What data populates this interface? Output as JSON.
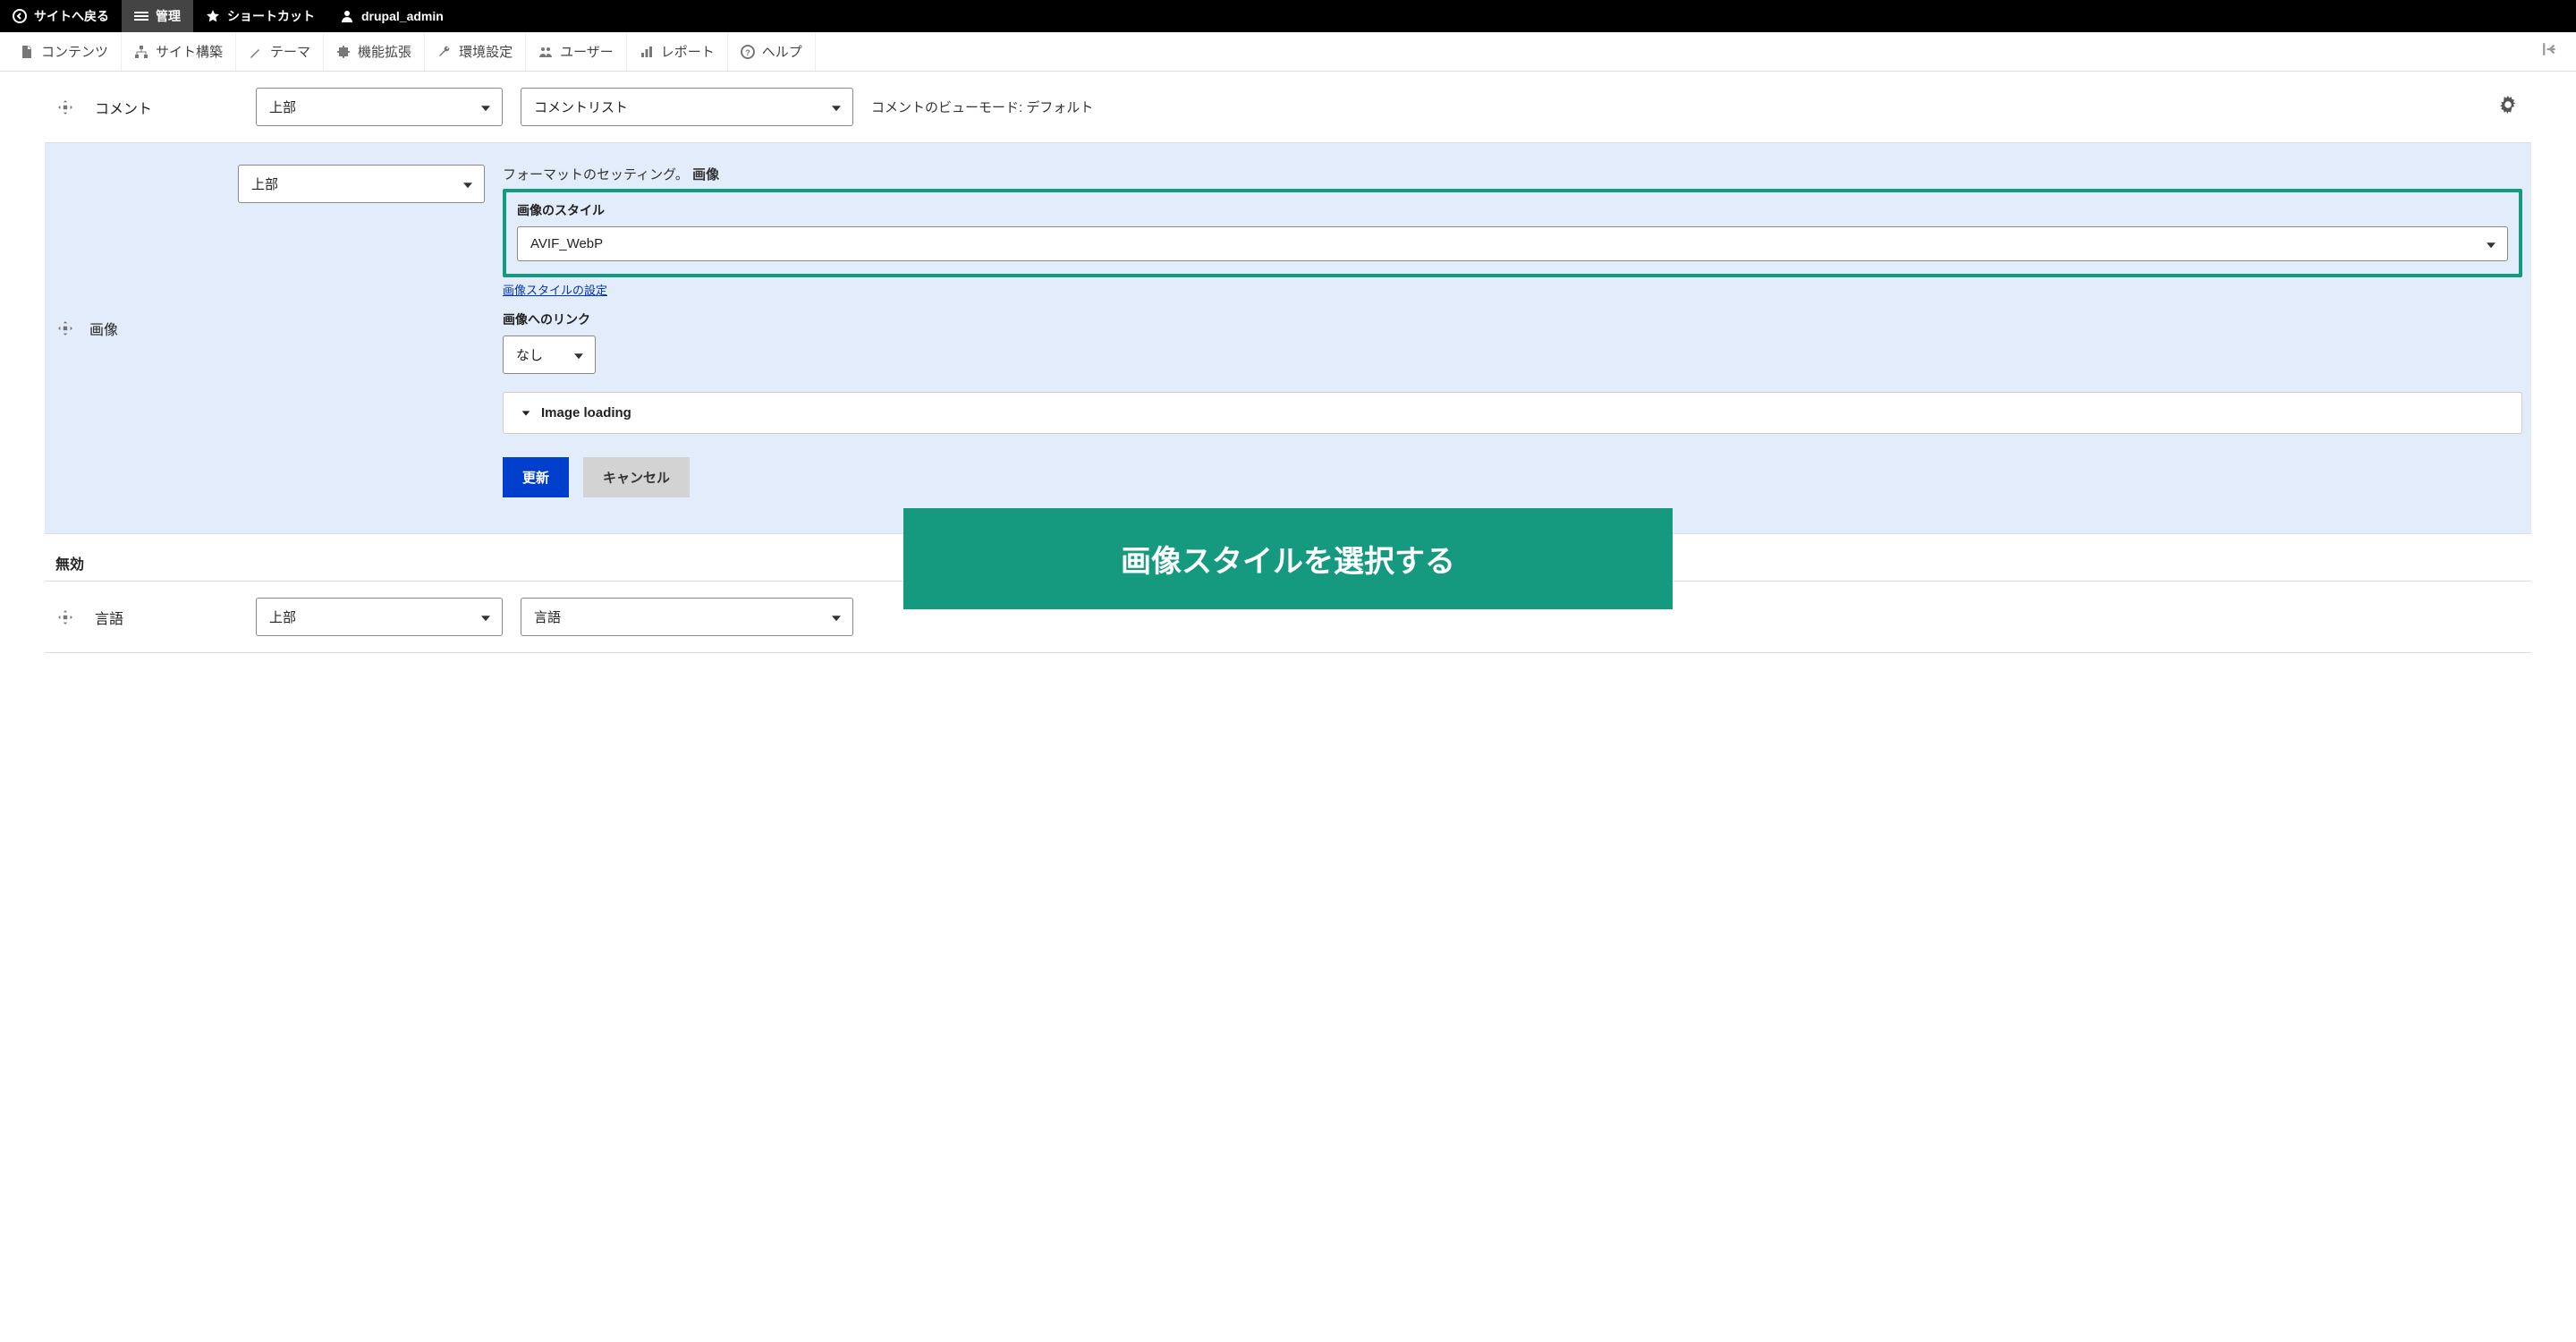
{
  "topbar": {
    "back": "サイトへ戻る",
    "manage": "管理",
    "shortcuts": "ショートカット",
    "user": "drupal_admin"
  },
  "adminmenu": {
    "content": "コンテンツ",
    "structure": "サイト構築",
    "appearance": "テーマ",
    "extend": "機能拡張",
    "config": "環境設定",
    "people": "ユーザー",
    "reports": "レポート",
    "help": "ヘルプ"
  },
  "rows": {
    "comment": {
      "label": "コメント",
      "region": "上部",
      "format": "コメントリスト",
      "summary": "コメントのビューモード: デフォルト"
    },
    "image": {
      "label": "画像",
      "region": "上部",
      "fs_heading_prefix": "フォーマットのセッティング。 ",
      "fs_heading_bold": "画像",
      "style_label": "画像のスタイル",
      "style_value": "AVIF_WebP",
      "style_link": "画像スタイルの設定",
      "link_label": "画像へのリンク",
      "link_value": "なし",
      "loading": "Image loading",
      "update": "更新",
      "cancel": "キャンセル"
    },
    "language": {
      "label": "言語",
      "region": "上部",
      "format": "言語"
    }
  },
  "disabled_header": "無効",
  "banner": "画像スタイルを選択する"
}
